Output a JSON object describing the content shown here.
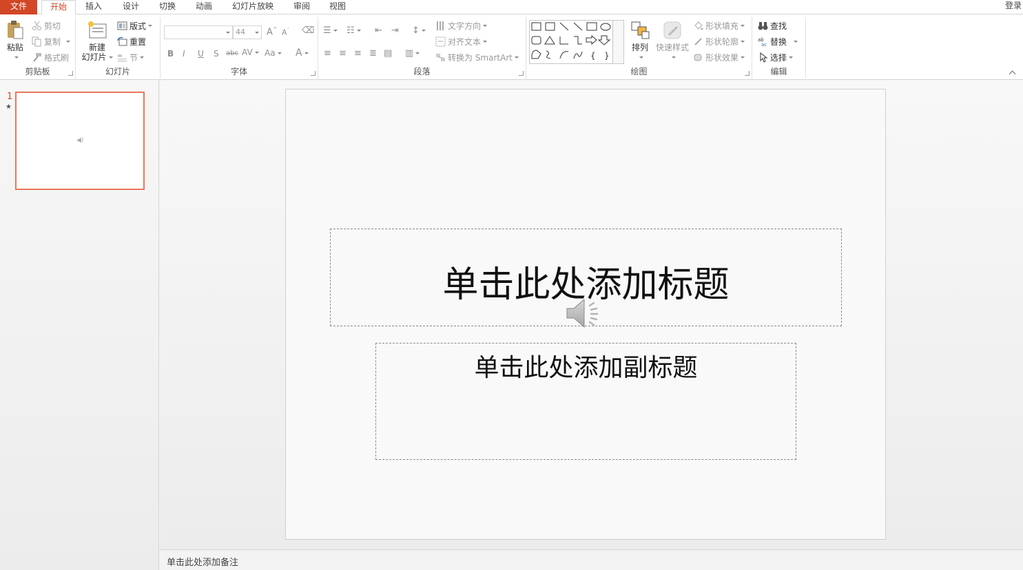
{
  "tabs": [
    {
      "label": "文件"
    },
    {
      "label": "开始"
    },
    {
      "label": "插入"
    },
    {
      "label": "设计"
    },
    {
      "label": "切换"
    },
    {
      "label": "动画"
    },
    {
      "label": "幻灯片放映"
    },
    {
      "label": "审阅"
    },
    {
      "label": "视图"
    }
  ],
  "account": {
    "login": "登录"
  },
  "clipboard": {
    "paste": "粘贴",
    "cut": "剪切",
    "copy": "复制",
    "format_painter": "格式刷",
    "label": "剪贴板"
  },
  "slides": {
    "new_slide_1": "新建",
    "new_slide_2": "幻灯片",
    "layout": "版式",
    "reset": "重置",
    "section": "节",
    "label": "幻灯片"
  },
  "font": {
    "size": "44",
    "change_case": "Aa",
    "label": "字体"
  },
  "paragraph": {
    "text_direction": "文字方向",
    "align_text": "对齐文本",
    "convert_smartart": "转换为 SmartArt",
    "label": "段落"
  },
  "drawing": {
    "arrange": "排列",
    "quick_styles": "快速样式",
    "shape_fill": "形状填充",
    "shape_outline": "形状轮廓",
    "shape_effects": "形状效果",
    "label": "绘图"
  },
  "editing": {
    "find": "查找",
    "replace": "替换",
    "select": "选择",
    "label": "编辑"
  },
  "thumbnail": {
    "number": "1",
    "star": "★"
  },
  "slide": {
    "title_placeholder": "单击此处添加标题",
    "subtitle_placeholder": "单击此处添加副标题"
  },
  "notes": {
    "placeholder": "单击此处添加备注"
  },
  "colors": {
    "accent": "#d24726",
    "thumb_border": "#e8785b"
  }
}
